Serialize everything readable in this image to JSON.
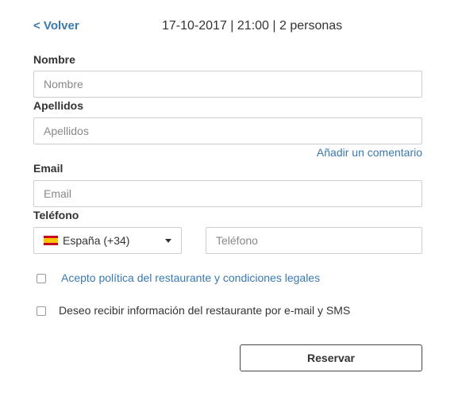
{
  "header": {
    "back_label": "< Volver",
    "summary": "17-10-2017 | 21:00 | 2 personas"
  },
  "form": {
    "nombre": {
      "label": "Nombre",
      "placeholder": "Nombre",
      "value": ""
    },
    "apellidos": {
      "label": "Apellidos",
      "placeholder": "Apellidos",
      "value": ""
    },
    "comment_link": "Añadir un comentario",
    "email": {
      "label": "Email",
      "placeholder": "Email",
      "value": ""
    },
    "telefono": {
      "label": "Teléfono",
      "country": {
        "flag_icon": "spain-flag-icon",
        "selected": "España (+34)"
      },
      "placeholder": "Teléfono",
      "value": ""
    },
    "policy_checkbox": {
      "label": "Acepto política del restaurante y condiciones legales",
      "checked": false
    },
    "newsletter_checkbox": {
      "label": "Deseo recibir información del restaurante por e-mail y SMS",
      "checked": false
    },
    "submit_label": "Reservar"
  },
  "colors": {
    "link": "#3a79b0",
    "text": "#333333",
    "border": "#cfcfcf"
  }
}
